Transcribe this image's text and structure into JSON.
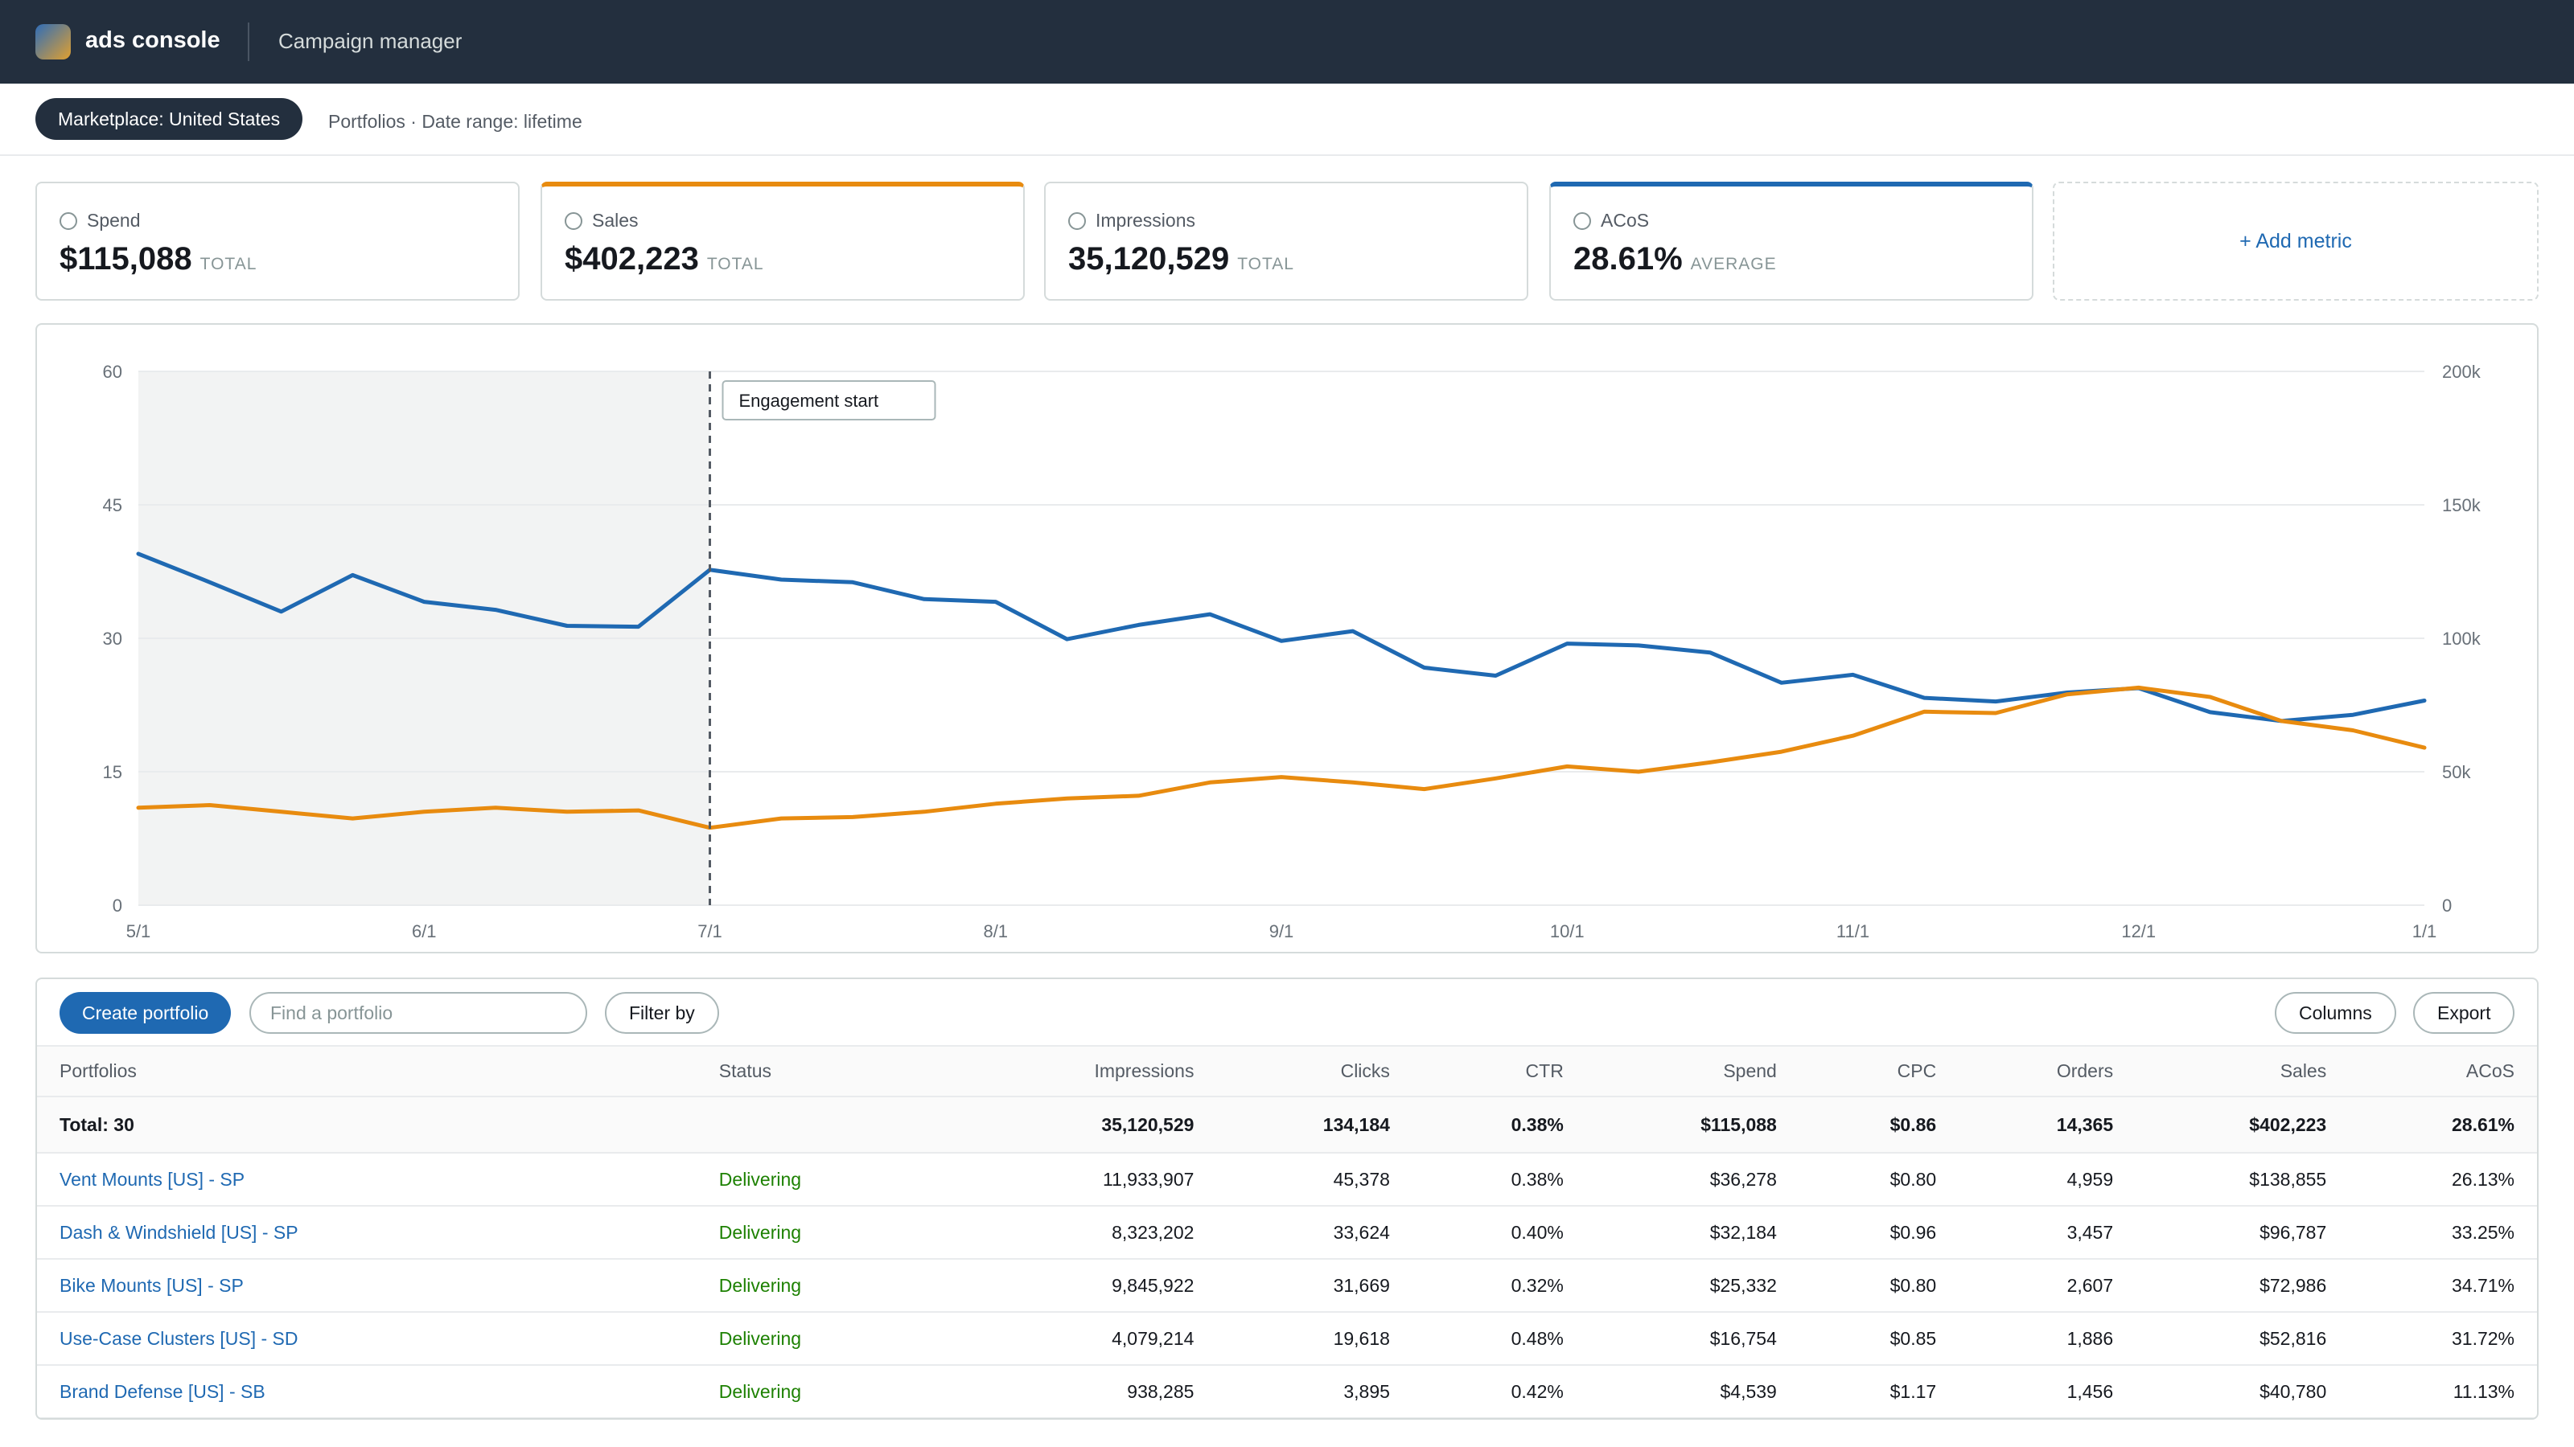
{
  "header": {
    "brand": "ads console",
    "nav": "Campaign manager"
  },
  "subbar": {
    "marketplace": "Marketplace: United States",
    "crumbs": "Portfolios · Date range: lifetime"
  },
  "metrics": [
    {
      "label": "Spend",
      "value": "$115,088",
      "suffix": "TOTAL",
      "selected": false,
      "color": ""
    },
    {
      "label": "Sales",
      "value": "$402,223",
      "suffix": "TOTAL",
      "selected": true,
      "color": "#e88b0f"
    },
    {
      "label": "Impressions",
      "value": "35,120,529",
      "suffix": "TOTAL",
      "selected": false,
      "color": ""
    },
    {
      "label": "ACoS",
      "value": "28.61%",
      "suffix": "AVERAGE",
      "selected": true,
      "color": "#1f69b2"
    }
  ],
  "add_metric": "+ Add metric",
  "chart_data": {
    "type": "line",
    "annotation": "Engagement start",
    "annotation_x": "7/1",
    "x_ticks": [
      "5/1",
      "6/1",
      "7/1",
      "8/1",
      "9/1",
      "10/1",
      "11/1",
      "12/1",
      "1/1"
    ],
    "y_left_ticks": [
      "0",
      "15",
      "30",
      "45",
      "60"
    ],
    "y_right_ticks": [
      "0",
      "50k",
      "100k",
      "150k",
      "200k"
    ],
    "ylim_left": [
      0,
      60
    ],
    "ylim_right": [
      0,
      200000
    ],
    "grid": true,
    "series": [
      {
        "axis": "left",
        "color": "#1f69b2",
        "values": [
          39.5,
          36.3,
          33.0,
          37.1,
          34.1,
          33.2,
          31.4,
          31.3,
          37.7,
          36.6,
          36.3,
          34.4,
          34.1,
          29.9,
          31.5,
          32.7,
          29.7,
          30.8,
          26.7,
          25.8,
          29.4,
          29.2,
          28.4,
          25.0,
          25.9,
          23.3,
          22.9,
          23.9,
          24.4,
          21.7,
          20.7,
          21.4,
          23.0
        ]
      },
      {
        "axis": "right",
        "color": "#e88b0f",
        "values": [
          36500,
          37500,
          35000,
          32500,
          35000,
          36500,
          35000,
          35500,
          29000,
          32500,
          33000,
          35000,
          38000,
          40000,
          41000,
          46000,
          48000,
          46000,
          43500,
          47500,
          52000,
          50000,
          53500,
          57500,
          63500,
          72500,
          72000,
          79000,
          81500,
          78000,
          69000,
          65500,
          59000
        ]
      }
    ]
  },
  "table": {
    "create_label": "Create portfolio",
    "search_placeholder": "Find a portfolio",
    "filter_label": "Filter by",
    "columns_label": "Columns",
    "export_label": "Export",
    "headers": [
      "Portfolios",
      "Status",
      "Impressions",
      "Clicks",
      "CTR",
      "Spend",
      "CPC",
      "Orders",
      "Sales",
      "ACoS"
    ],
    "total": [
      "Total: 30",
      "",
      "35,120,529",
      "134,184",
      "0.38%",
      "$115,088",
      "$0.86",
      "14,365",
      "$402,223",
      "28.61%"
    ],
    "rows": [
      [
        "Vent Mounts [US] - SP",
        "Delivering",
        "11,933,907",
        "45,378",
        "0.38%",
        "$36,278",
        "$0.80",
        "4,959",
        "$138,855",
        "26.13%"
      ],
      [
        "Dash & Windshield [US] - SP",
        "Delivering",
        "8,323,202",
        "33,624",
        "0.40%",
        "$32,184",
        "$0.96",
        "3,457",
        "$96,787",
        "33.25%"
      ],
      [
        "Bike Mounts [US] - SP",
        "Delivering",
        "9,845,922",
        "31,669",
        "0.32%",
        "$25,332",
        "$0.80",
        "2,607",
        "$72,986",
        "34.71%"
      ],
      [
        "Use-Case Clusters [US] - SD",
        "Delivering",
        "4,079,214",
        "19,618",
        "0.48%",
        "$16,754",
        "$0.85",
        "1,886",
        "$52,816",
        "31.72%"
      ],
      [
        "Brand Defense [US] - SB",
        "Delivering",
        "938,285",
        "3,895",
        "0.42%",
        "$4,539",
        "$1.17",
        "1,456",
        "$40,780",
        "11.13%"
      ]
    ]
  }
}
